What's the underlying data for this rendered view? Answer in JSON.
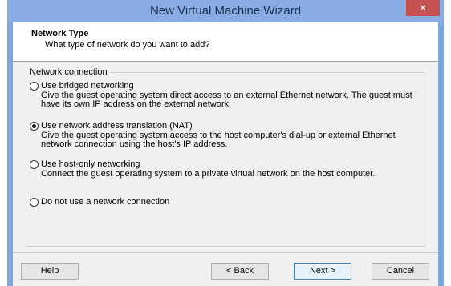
{
  "window": {
    "title": "New Virtual Machine Wizard",
    "close_glyph": "✕"
  },
  "header": {
    "title": "Network Type",
    "subtitle": "What type of network do you want to add?"
  },
  "network_group": {
    "legend": "Network connection",
    "options": [
      {
        "label": "Use bridged networking",
        "description": "Give the guest operating system direct access to an external Ethernet network. The guest must have its own IP address on the external network.",
        "selected": false
      },
      {
        "label": "Use network address translation (NAT)",
        "description": "Give the guest operating system access to the host computer's dial-up or external Ethernet network connection using the host's IP address.",
        "selected": true
      },
      {
        "label": "Use host-only networking",
        "description": "Connect the guest operating system to a private virtual network on the host computer.",
        "selected": false
      },
      {
        "label": "Do not use a network connection",
        "description": "",
        "selected": false
      }
    ]
  },
  "buttons": {
    "help": "Help",
    "back": "< Back",
    "next": "Next >",
    "cancel": "Cancel"
  },
  "colors": {
    "frame": "#7ea7e0",
    "close_button": "#c75050",
    "client": "#f0f0f0"
  }
}
